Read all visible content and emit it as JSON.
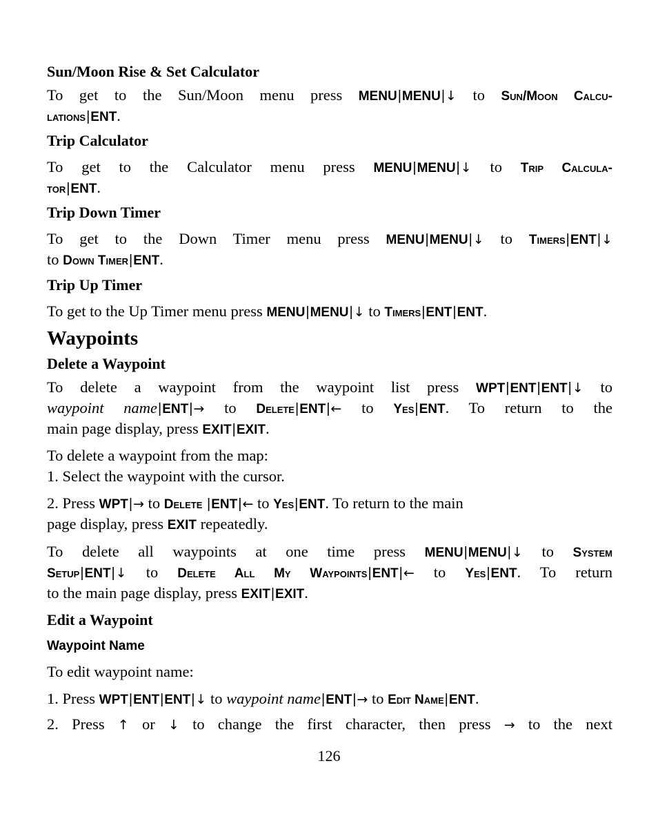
{
  "sections": {
    "sun_moon": {
      "heading": "Sun/Moon Rise & Set Calculator",
      "l1_a": "To get to the Sun/Moon menu press ",
      "k1": "MENU",
      "k2": "MENU",
      "arrow1": "↓",
      "to": " to ",
      "sc1": "Sun/Moon Calcu-",
      "sc2": "lations",
      "k3": "ENT",
      "end": "."
    },
    "trip_calc": {
      "heading": "Trip Calculator",
      "l1_a": "To get to the Calculator menu press ",
      "k1": "MENU",
      "k2": "MENU",
      "arrow1": "↓",
      "to": " to ",
      "sc1": "Trip Calcula-",
      "sc2": "tor",
      "k3": "ENT",
      "end": "."
    },
    "down_timer": {
      "heading": "Trip Down Timer",
      "l1_a": "To get to the Down Timer menu press ",
      "k1": "MENU",
      "k2": "MENU",
      "arrow1": "↓",
      "to": " to ",
      "sc1": "Timers",
      "k3": "ENT",
      "arrow2": "↓",
      "l2_a": "to ",
      "sc2": "Down Timer",
      "k4": "ENT",
      "end": "."
    },
    "up_timer": {
      "heading": "Trip Up Timer",
      "l1_a": "To get to the Up Timer menu press ",
      "k1": "MENU",
      "k2": "MENU",
      "arrow1": "↓",
      "to": " to ",
      "sc1": "Timers",
      "k3": "ENT",
      "k4": "ENT",
      "end": "."
    },
    "waypoints": {
      "heading": "Waypoints"
    },
    "delete_waypoint": {
      "heading": "Delete a Waypoint",
      "p1": {
        "a": "To delete a waypoint from the waypoint list press ",
        "k1": "WPT",
        "k2": "ENT",
        "k3": "ENT",
        "arrow1": "↓",
        "to1": " to",
        "it": "waypoint name",
        "k4": "ENT",
        "arrow2": "→",
        "to2": " to ",
        "sc1": "Delete",
        "k5": "ENT",
        "arrow3": "←",
        "to3": " to ",
        "sc2": "Yes",
        "k6": "ENT",
        "b": ". To return to the",
        "c": "main page display, press ",
        "k7": "EXIT",
        "k8": "EXIT",
        "end": "."
      },
      "p2": "To delete a waypoint from the map:",
      "step1": "1. Select the waypoint with the cursor.",
      "step2": {
        "a": "2. Press ",
        "k1": "WPT",
        "arrow1": "→",
        "to1": " to ",
        "sc1": "Delete",
        "k2": "ENT",
        "arrow2": "←",
        "to2": " to ",
        "sc2": "Yes",
        "k3": "ENT",
        "b": ". To return to the main",
        "c": "page display, press ",
        "k4": "EXIT",
        "d": " repeatedly."
      },
      "p3": {
        "a": "To delete all waypoints at one time press ",
        "k1": "MENU",
        "k2": "MENU",
        "arrow1": "↓",
        "to1": " to ",
        "sc1": "System",
        "sc2": "Setup",
        "k3": "ENT",
        "arrow2": "↓",
        "to2": " to ",
        "sc3": "Delete All My Waypoints",
        "k4": "ENT",
        "arrow3": "←",
        "to3": " to ",
        "sc4": "Yes",
        "k5": "ENT",
        "b": ". To return",
        "c": "to the main page display, press ",
        "k6": "EXIT",
        "k7": "EXIT",
        "end": "."
      }
    },
    "edit_waypoint": {
      "heading": "Edit a Waypoint",
      "subheading": "Waypoint Name",
      "p1": "To edit waypoint name:",
      "step1": {
        "a": "1. Press ",
        "k1": "WPT",
        "k2": "ENT",
        "k3": "ENT",
        "arrow1": "↓",
        "to1": " to ",
        "it": "waypoint name",
        "k4": "ENT",
        "arrow2": "→",
        "to2": " to ",
        "sc1": "Edit Name",
        "k5": "ENT",
        "end": "."
      },
      "step2": {
        "a": "2. Press ",
        "arrow1": "↑",
        "b": " or ",
        "arrow2": "↓",
        "c": " to change the first character, then press ",
        "arrow3": "→",
        "d": " to the next"
      }
    }
  },
  "separator": "|",
  "page_number": "126"
}
